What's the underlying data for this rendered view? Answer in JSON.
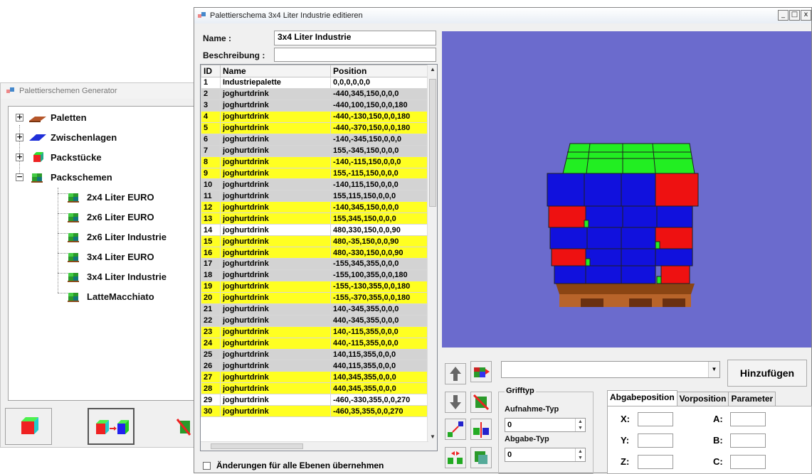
{
  "generator": {
    "title": "Palettierschemen Generator",
    "tree": [
      {
        "label": "Paletten",
        "expander": "+"
      },
      {
        "label": "Zwischenlagen",
        "expander": "+"
      },
      {
        "label": "Packstücke",
        "expander": "+"
      },
      {
        "label": "Packschemen",
        "expander": "−"
      }
    ],
    "schemes": [
      "2x4 Liter EURO",
      "2x6 Liter EURO",
      "2x6 Liter Industrie",
      "3x4 Liter EURO",
      "3x4 Liter Industrie",
      "LatteMacchiato"
    ]
  },
  "dialog": {
    "title": "Palettierschema 3x4 Liter Industrie editieren",
    "name_label": "Name :",
    "name_value": "3x4 Liter Industrie",
    "desc_label": "Beschreibung :",
    "desc_value": "",
    "columns": [
      "ID",
      "Name",
      "Position"
    ],
    "rows": [
      [
        "1",
        "Industriepalette",
        "0,0,0,0,0,0",
        "white"
      ],
      [
        "2",
        "joghurtdrink",
        "-440,345,150,0,0,0",
        "gray"
      ],
      [
        "3",
        "joghurtdrink",
        "-440,100,150,0,0,180",
        "gray"
      ],
      [
        "4",
        "joghurtdrink",
        "-440,-130,150,0,0,180",
        "yellow"
      ],
      [
        "5",
        "joghurtdrink",
        "-440,-370,150,0,0,180",
        "yellow"
      ],
      [
        "6",
        "joghurtdrink",
        "-140,-345,150,0,0,0",
        "gray"
      ],
      [
        "7",
        "joghurtdrink",
        "155,-345,150,0,0,0",
        "gray"
      ],
      [
        "8",
        "joghurtdrink",
        "-140,-115,150,0,0,0",
        "yellow"
      ],
      [
        "9",
        "joghurtdrink",
        "155,-115,150,0,0,0",
        "yellow"
      ],
      [
        "10",
        "joghurtdrink",
        "-140,115,150,0,0,0",
        "gray"
      ],
      [
        "11",
        "joghurtdrink",
        "155,115,150,0,0,0",
        "gray"
      ],
      [
        "12",
        "joghurtdrink",
        "-140,345,150,0,0,0",
        "yellow"
      ],
      [
        "13",
        "joghurtdrink",
        "155,345,150,0,0,0",
        "yellow"
      ],
      [
        "14",
        "joghurtdrink",
        "480,330,150,0,0,90",
        "white"
      ],
      [
        "15",
        "joghurtdrink",
        "480,-35,150,0,0,90",
        "yellow"
      ],
      [
        "16",
        "joghurtdrink",
        "480,-330,150,0,0,90",
        "yellow"
      ],
      [
        "17",
        "joghurtdrink",
        "-155,345,355,0,0,0",
        "gray"
      ],
      [
        "18",
        "joghurtdrink",
        "-155,100,355,0,0,180",
        "gray"
      ],
      [
        "19",
        "joghurtdrink",
        "-155,-130,355,0,0,180",
        "yellow"
      ],
      [
        "20",
        "joghurtdrink",
        "-155,-370,355,0,0,180",
        "yellow"
      ],
      [
        "21",
        "joghurtdrink",
        "140,-345,355,0,0,0",
        "gray"
      ],
      [
        "22",
        "joghurtdrink",
        "440,-345,355,0,0,0",
        "gray"
      ],
      [
        "23",
        "joghurtdrink",
        "140,-115,355,0,0,0",
        "yellow"
      ],
      [
        "24",
        "joghurtdrink",
        "440,-115,355,0,0,0",
        "yellow"
      ],
      [
        "25",
        "joghurtdrink",
        "140,115,355,0,0,0",
        "gray"
      ],
      [
        "26",
        "joghurtdrink",
        "440,115,355,0,0,0",
        "gray"
      ],
      [
        "27",
        "joghurtdrink",
        "140,345,355,0,0,0",
        "yellow"
      ],
      [
        "28",
        "joghurtdrink",
        "440,345,355,0,0,0",
        "yellow"
      ],
      [
        "29",
        "joghurtdrink",
        "-460,-330,355,0,0,270",
        "white"
      ],
      [
        "30",
        "joghurtdrink",
        "-460,35,355,0,0,270",
        "yellow"
      ]
    ],
    "apply_all_label": "Änderungen für alle Ebenen übernehmen",
    "combo_value": "",
    "add_button": "Hinzufügen",
    "grip": {
      "legend": "Grifftyp",
      "pick_label": "Aufnahme-Typ",
      "pick_value": "0",
      "place_label": "Abgabe-Typ",
      "place_value": "0"
    },
    "tabs": [
      "Abgabeposition",
      "Vorposition",
      "Parameter"
    ],
    "coords": {
      "x": "X:",
      "y": "Y:",
      "z": "Z:",
      "a": "A:",
      "b": "B:",
      "c": "C:"
    }
  },
  "colors": {
    "row_yellow": "#ffff22",
    "row_gray": "#d3d3d3",
    "row_white": "#ffffff",
    "view_bg": "#6b6bcd",
    "box_blue": "#1010e0",
    "box_red": "#ee1111",
    "box_green": "#11ee11"
  }
}
